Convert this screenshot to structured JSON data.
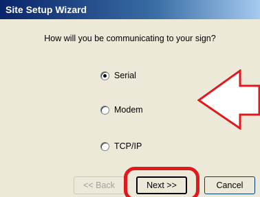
{
  "window": {
    "title": "Site Setup Wizard"
  },
  "question": "How will you be communicating to your sign?",
  "options": [
    {
      "label": "Serial",
      "selected": true
    },
    {
      "label": "Modem",
      "selected": false
    },
    {
      "label": "TCP/IP",
      "selected": false
    }
  ],
  "buttons": {
    "back": "<< Back",
    "next": "Next >>",
    "cancel": "Cancel"
  },
  "colors": {
    "annotation_red": "#e0191f",
    "title_bar": "#0a246a",
    "dialog_bg": "#ece9d8"
  }
}
